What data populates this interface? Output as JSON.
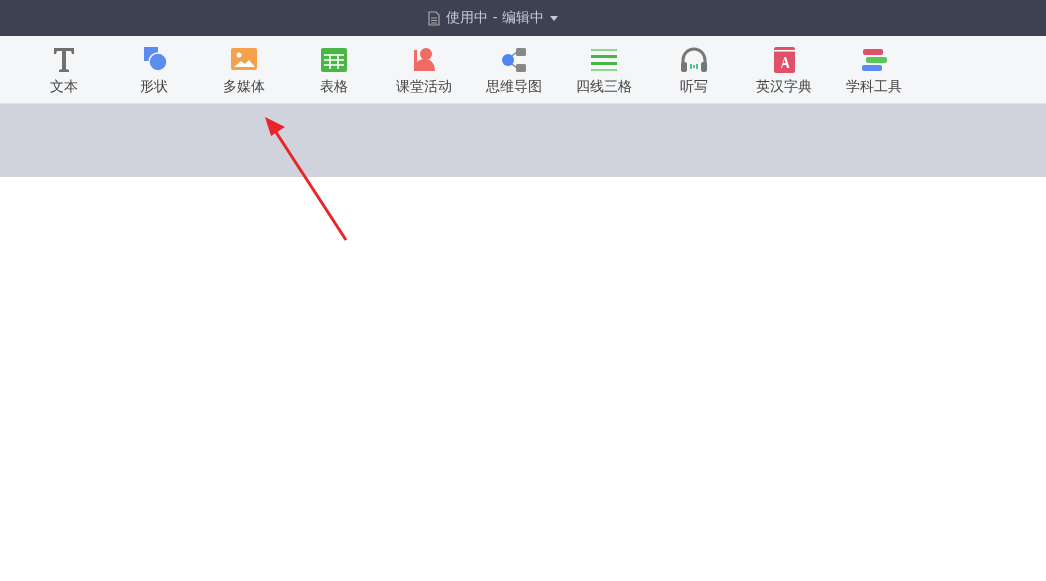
{
  "title_bar": {
    "title": "使用中 - 编辑中"
  },
  "toolbar": {
    "items": [
      {
        "kind": "text",
        "label": "文本"
      },
      {
        "kind": "shape",
        "label": "形状"
      },
      {
        "kind": "media",
        "label": "多媒体"
      },
      {
        "kind": "table",
        "label": "表格"
      },
      {
        "kind": "activity",
        "label": "课堂活动"
      },
      {
        "kind": "mindmap",
        "label": "思维导图"
      },
      {
        "kind": "lines",
        "label": "四线三格"
      },
      {
        "kind": "dictation",
        "label": "听写"
      },
      {
        "kind": "dictionary",
        "label": "英汉字典"
      },
      {
        "kind": "tools",
        "label": "学科工具"
      }
    ]
  }
}
